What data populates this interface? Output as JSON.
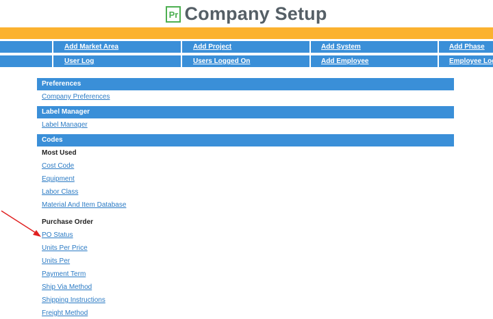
{
  "header": {
    "logo_text": "Pr",
    "title": "Company Setup"
  },
  "nav": {
    "row1": [
      "Add Market Area",
      "Add Project",
      "Add System",
      "Add Phase"
    ],
    "row2": [
      "User Log",
      "Users Logged On",
      "Add Employee",
      "Employee Log"
    ]
  },
  "sections": {
    "preferences": {
      "title": "Preferences",
      "links": [
        "Company Preferences"
      ]
    },
    "label_manager": {
      "title": "Label Manager",
      "links": [
        "Label Manager"
      ]
    },
    "codes": {
      "title": "Codes",
      "most_used": {
        "title": "Most Used",
        "links": [
          "Cost Code",
          "Equipment",
          "Labor Class",
          "Material And Item Database"
        ]
      },
      "purchase_order": {
        "title": "Purchase Order",
        "links": [
          "PO Status",
          "Units Per Price",
          "Units Per",
          "Payment Term",
          "Ship Via Method",
          "Shipping Instructions",
          "Freight Method"
        ]
      }
    }
  },
  "annotation": {
    "arrow_color": "#e02020"
  },
  "colors": {
    "accent_blue": "#3a8fd8",
    "orange": "#fbb22f",
    "link": "#2a7ac4",
    "logo_green": "#4caf50"
  }
}
